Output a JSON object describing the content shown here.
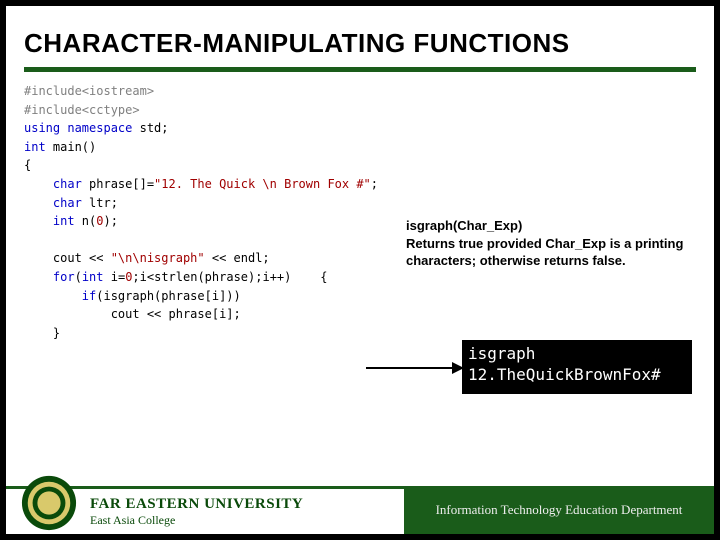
{
  "title": "CHARACTER-MANIPULATING FUNCTIONS",
  "code": {
    "l1a": "#include",
    "l1b": "<iostream>",
    "l2a": "#include",
    "l2b": "<cctype>",
    "l3a": "using",
    "l3b": " namespace",
    "l3c": " std;",
    "l4a": "int",
    "l4b": " main()",
    "l5": "{",
    "l6a": "    char",
    "l6b": " phrase[]=",
    "l6c": "\"12. The Quick \\n Brown Fox #\"",
    "l6d": ";",
    "l7a": "    char",
    "l7b": " ltr;",
    "l8a": "    int",
    "l8b": " n(",
    "l8c": "0",
    "l8d": ");",
    "blank1": "",
    "l9a": "    cout << ",
    "l9b": "\"\\n\\nisgraph\"",
    "l9c": " << endl;",
    "l10a": "    for",
    "l10b": "(",
    "l10c": "int",
    "l10d": " i=",
    "l10e": "0",
    "l10f": ";i<strlen(phrase);i++)    {",
    "l11a": "        if",
    "l11b": "(isgraph(phrase[i]))",
    "l12": "            cout << phrase[i];",
    "l13": "    }"
  },
  "callout": {
    "fn": "isgraph(Char_Exp)",
    "desc": "Returns true provided Char_Exp is a printing characters; otherwise returns false."
  },
  "console": {
    "line1": "isgraph",
    "line2": "12.TheQuickBrownFox#"
  },
  "footer": {
    "uni_main": "FAR EASTERN UNIVERSITY",
    "uni_sub": "East Asia College",
    "dept": "Information Technology Education Department"
  }
}
